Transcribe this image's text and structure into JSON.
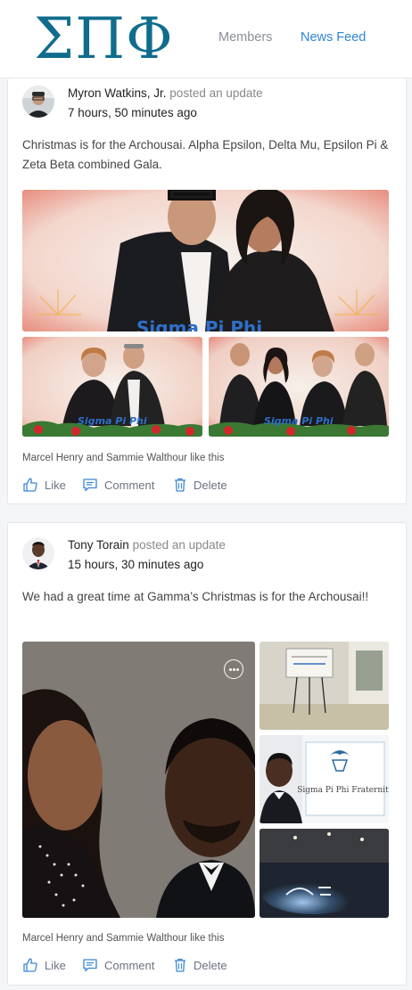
{
  "header": {
    "logo_text": "ΣΠΦ",
    "nav_members": "Members",
    "nav_news_feed": "News Feed"
  },
  "posts": [
    {
      "author": "Myron Watkins, Jr.",
      "action": "posted an update",
      "time": "7 hours, 50 minutes ago",
      "text": "Christmas is for the Archousai. Alpha Epsilon, Delta Mu, Epsilon Pi & Zeta Beta combined Gala.",
      "photo_caption": "Sigma Pi Phi",
      "likes": "Marcel Henry and Sammie Walthour like this",
      "like_label": "Like",
      "comment_label": "Comment",
      "delete_label": "Delete"
    },
    {
      "author": "Tony Torain",
      "action": "posted an update",
      "time": "15 hours, 30 minutes ago",
      "text": "We had a great time at Gamma’s Christmas is for the Archousai!!",
      "sign_text": "Sigma Pi Phi Fraternity",
      "likes": "Marcel Henry and Sammie Walthour like this",
      "like_label": "Like",
      "comment_label": "Comment",
      "delete_label": "Delete"
    }
  ],
  "colors": {
    "brand": "#106c8c",
    "link": "#2f84d8",
    "muted": "#8a8f98"
  },
  "icons": [
    "thumbs-up-icon",
    "comment-icon",
    "trash-icon",
    "more-options-icon"
  ]
}
